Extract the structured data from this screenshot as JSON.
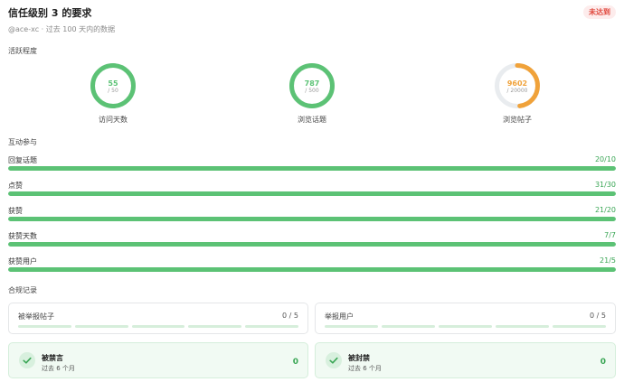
{
  "header": {
    "title": "信任级别 3 的要求",
    "badge": "未达到",
    "subtitle": "@ace-xc · 过去 100 天内的数据"
  },
  "activity": {
    "title": "活跃程度",
    "rings": [
      {
        "value": "55",
        "max": "/ 50",
        "label": "访问天数",
        "fraction": 1.0,
        "color": "#5cc275"
      },
      {
        "value": "787",
        "max": "/ 500",
        "label": "浏览话题",
        "fraction": 1.0,
        "color": "#5cc275"
      },
      {
        "value": "9602",
        "max": "/ 20000",
        "label": "浏览帖子",
        "fraction": 0.4801,
        "color": "#f0a23a"
      }
    ],
    "track_color": "#e9ecef"
  },
  "interaction": {
    "title": "互动参与",
    "bars": [
      {
        "label": "回复话题",
        "value": "20/10",
        "fraction": 1.0
      },
      {
        "label": "点赞",
        "value": "31/30",
        "fraction": 1.0
      },
      {
        "label": "获赞",
        "value": "21/20",
        "fraction": 1.0
      },
      {
        "label": "获赞天数",
        "value": "7/7",
        "fraction": 1.0
      },
      {
        "label": "获赞用户",
        "value": "21/5",
        "fraction": 1.0
      }
    ]
  },
  "compliance": {
    "title": "合规记录",
    "cards": [
      {
        "label": "被举报帖子",
        "value": "0 / 5",
        "segments": 5
      },
      {
        "label": "举报用户",
        "value": "0 / 5",
        "segments": 5
      }
    ],
    "status": [
      {
        "title": "被禁言",
        "sub": "过去 6 个月",
        "count": "0"
      },
      {
        "title": "被封禁",
        "sub": "过去 6 个月",
        "count": "0"
      }
    ]
  },
  "colors": {
    "accent_green": "#5cc275",
    "accent_orange": "#f0a23a",
    "badge_red": "#e0453a"
  },
  "icons": {
    "check": "check-icon"
  }
}
